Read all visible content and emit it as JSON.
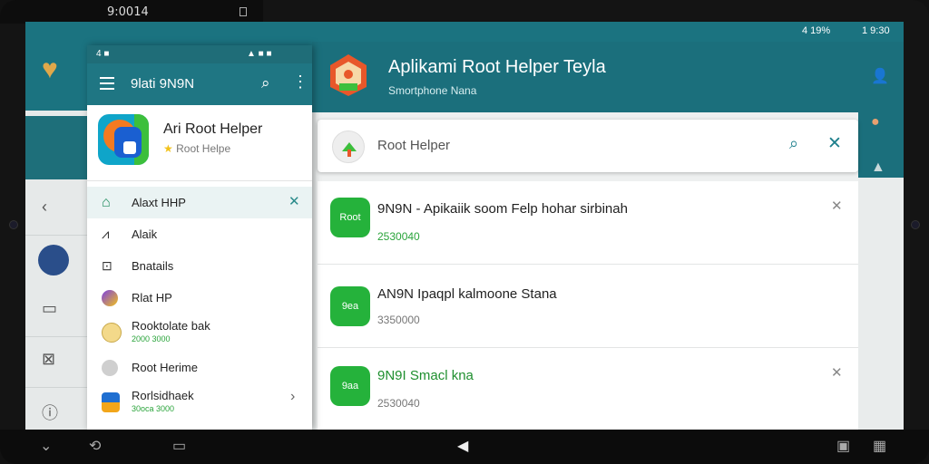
{
  "device": {
    "top_time": "9:0014"
  },
  "status": {
    "battery": "4 19%",
    "time": "1 9:30"
  },
  "drawer": {
    "status_left": "4 ■",
    "status_right": "▲ ■ ■",
    "title": "9lati 9N9N",
    "profile": {
      "name": "Ari Root Helper",
      "subtitle": "Root Helpe"
    },
    "items": [
      {
        "label": "Alaxt HHP",
        "sub": ""
      },
      {
        "label": "Alaik",
        "sub": ""
      },
      {
        "label": "Bnatails",
        "sub": ""
      },
      {
        "label": "Rlat HP",
        "sub": ""
      },
      {
        "label": "Rooktolate bak",
        "sub": "2000 3000"
      },
      {
        "label": "Root Herime",
        "sub": ""
      },
      {
        "label": "Rorlsidhaek",
        "sub": "30oca 3000"
      }
    ]
  },
  "main": {
    "title": "Aplikami Root Helper Teyla",
    "subtitle": "Smortphone Nana",
    "search": {
      "value": "Root Helper"
    },
    "results": [
      {
        "badge": "Root",
        "title": "9N9N - Apikaiik soom Felp hohar sirbinah",
        "number": "2530040"
      },
      {
        "badge": "9ea",
        "title": "AN9N Ipaqpl kalmoone Stana",
        "number": "3350000"
      },
      {
        "badge": "9aa",
        "title": "9N9I Smacl kna",
        "number": "2530040"
      }
    ]
  },
  "colors": {
    "teal": "#1b6f7c",
    "green": "#25b23b",
    "accent": "#1e7f8c"
  }
}
